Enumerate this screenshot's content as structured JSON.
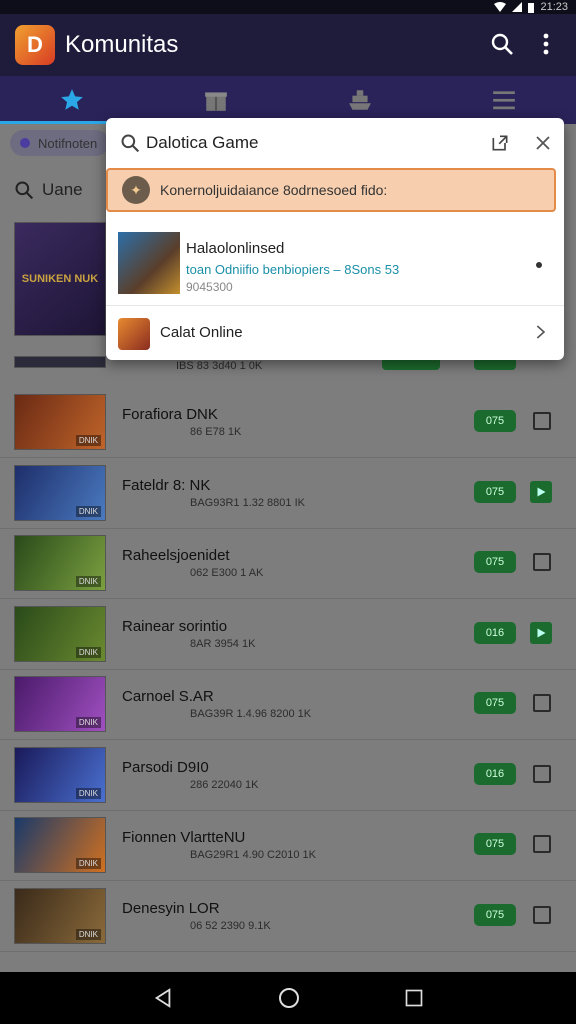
{
  "status": {
    "time": "21:23"
  },
  "app": {
    "title": "Komunitas",
    "logo_letter": "D"
  },
  "tabs": [
    {
      "icon": "star-icon",
      "active": true
    },
    {
      "icon": "gift-icon",
      "active": false
    },
    {
      "icon": "ship-icon",
      "active": false
    },
    {
      "icon": "menu-icon",
      "active": false
    }
  ],
  "content": {
    "notification_chip": "Notifnoten",
    "section_title": "Uane",
    "featured_label": "SUNIKEN NUK",
    "partial_row_meta": "IBS 83 3d40 1 0K",
    "rows": [
      {
        "title": "Forafiora DNK",
        "meta": "86 E78 1K",
        "badge": "075",
        "action": "checkbox",
        "thumb_label": "DNIK"
      },
      {
        "title": "Fateldr 8: NK",
        "meta": "BAG93R1 1.32 8801 IK",
        "badge": "075",
        "action": "play",
        "thumb_label": "DNIK"
      },
      {
        "title": "Raheelsjoenidet",
        "meta": "062 E300 1 AK",
        "badge": "075",
        "action": "checkbox",
        "thumb_label": "DNIK"
      },
      {
        "title": "Rainear sorintio",
        "meta": "8AR 3954 1K",
        "badge": "016",
        "action": "play",
        "thumb_label": "DNIK"
      },
      {
        "title": "Carnoel S.AR",
        "meta": "BAG39R 1.4.96 8200 1K",
        "badge": "075",
        "action": "checkbox",
        "thumb_label": "DNIK"
      },
      {
        "title": "Parsodi D9I0",
        "meta": "286 22040 1K",
        "badge": "016",
        "action": "checkbox",
        "thumb_label": "DNIK"
      },
      {
        "title": "Fionnen VlartteNU",
        "meta": "BAG29R1 4.90 C2010 1K",
        "badge": "075",
        "action": "checkbox",
        "thumb_label": "DNIK"
      },
      {
        "title": "Denesyin LOR",
        "meta": "06 52 2390 9.1K",
        "badge": "075",
        "action": "checkbox",
        "thumb_label": "DNIK"
      }
    ]
  },
  "search": {
    "query": "Dalotica Game",
    "placeholder": "Search",
    "highlight_text": "Konernoljuidaiance 8odrnesoed fido:",
    "result": {
      "title": "Halaolonlinsed",
      "subtitle": "toan Odniifio benbiopiers – 8Sons 53",
      "code": "9045300"
    },
    "suggestion": "Calat Online"
  }
}
